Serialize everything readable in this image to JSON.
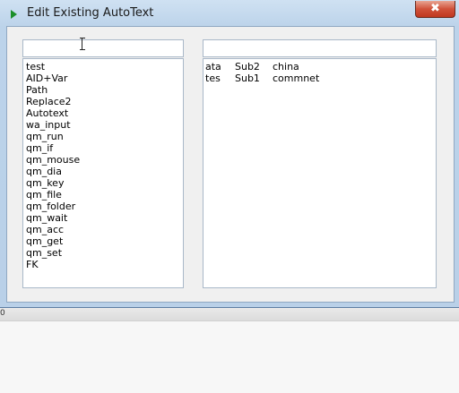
{
  "window": {
    "title": "Edit Existing AutoText",
    "close_glyph": "✖"
  },
  "left_panel": {
    "filter_value": "",
    "items": [
      "test",
      "AID+Var",
      "Path",
      "Replace2",
      "Autotext",
      "wa_input",
      "qm_run",
      "qm_if",
      "qm_mouse",
      "qm_dia",
      "qm_key",
      "qm_file",
      "qm_folder",
      "qm_wait",
      "qm_acc",
      "qm_get",
      "qm_set",
      "FK"
    ]
  },
  "right_panel": {
    "filter_value": "",
    "rows": [
      {
        "name": "ata",
        "sub": "Sub2",
        "text": "china"
      },
      {
        "name": "tes",
        "sub": "Sub1",
        "text": "commnet"
      }
    ]
  },
  "background": {
    "edge_digit": "0"
  },
  "colors": {
    "title_bar": "#bcd3ea",
    "close_button": "#c0381f",
    "app_icon": "#1c8f2a"
  }
}
